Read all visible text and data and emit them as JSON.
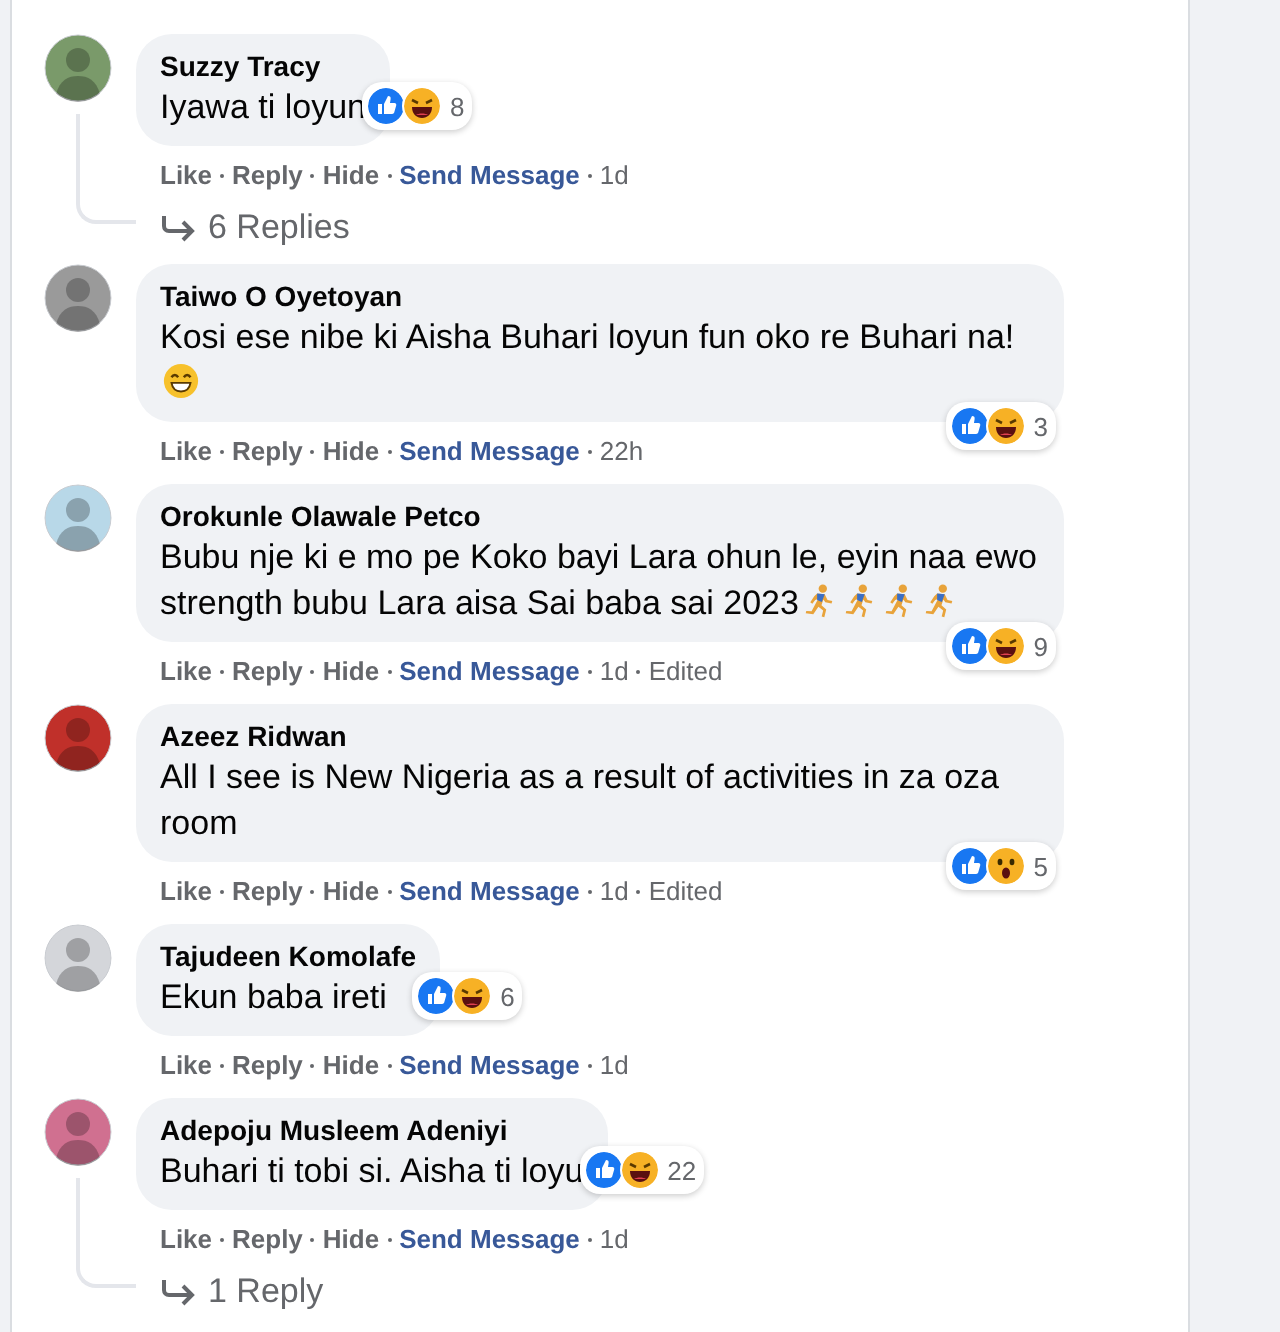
{
  "comments": [
    {
      "author": "Suzzy Tracy",
      "avatar": {
        "color": "#7a9a6a"
      },
      "text": "Iyawa ti loyun",
      "reactions": [
        {
          "kind": "like"
        },
        {
          "kind": "haha"
        }
      ],
      "reaction_count": "8",
      "actions": [
        "Like",
        "Reply",
        "Hide"
      ],
      "link": "Send Message",
      "time": "1d",
      "replies": "6 Replies"
    },
    {
      "author": "Taiwo O Oyetoyan",
      "avatar": {
        "color": "#9a9a9a"
      },
      "text": "Kosi ese nibe ki Aisha Buhari loyun fun oko re Buhari na!",
      "emoji": [
        {
          "kind": "grin"
        }
      ],
      "reactions": [
        {
          "kind": "like"
        },
        {
          "kind": "haha"
        }
      ],
      "reaction_count": "3",
      "actions": [
        "Like",
        "Reply",
        "Hide"
      ],
      "link": "Send Message",
      "time": "22h"
    },
    {
      "author": "Orokunle Olawale Petco",
      "avatar": {
        "color": "#b8d8e8"
      },
      "text": "Bubu nje ki e mo pe Koko bayi Lara ohun le, eyin naa ewo strength bubu Lara aisa Sai baba sai 2023",
      "emoji": [
        {
          "kind": "runner"
        },
        {
          "kind": "runner"
        },
        {
          "kind": "runner"
        },
        {
          "kind": "runner"
        }
      ],
      "reactions": [
        {
          "kind": "like"
        },
        {
          "kind": "haha"
        }
      ],
      "reaction_count": "9",
      "actions": [
        "Like",
        "Reply",
        "Hide"
      ],
      "link": "Send Message",
      "time": "1d",
      "edited": "Edited"
    },
    {
      "author": "Azeez Ridwan",
      "avatar": {
        "color": "#c0302a"
      },
      "text": "All I see is New Nigeria as a result of activities in za oza room",
      "reactions": [
        {
          "kind": "like"
        },
        {
          "kind": "wow"
        }
      ],
      "reaction_count": "5",
      "actions": [
        "Like",
        "Reply",
        "Hide"
      ],
      "link": "Send Message",
      "time": "1d",
      "edited": "Edited"
    },
    {
      "author": "Tajudeen Komolafe",
      "avatar": {
        "color": "#d4d6da"
      },
      "text": "Ekun baba ireti",
      "reactions": [
        {
          "kind": "like"
        },
        {
          "kind": "haha"
        }
      ],
      "reaction_count": "6",
      "actions": [
        "Like",
        "Reply",
        "Hide"
      ],
      "link": "Send Message",
      "time": "1d"
    },
    {
      "author": "Adepoju Musleem Adeniyi",
      "avatar": {
        "color": "#d07090"
      },
      "text": "Buhari ti tobi si. Aisha ti loyu",
      "reactions": [
        {
          "kind": "like"
        },
        {
          "kind": "haha"
        }
      ],
      "reaction_count": "22",
      "actions": [
        "Like",
        "Reply",
        "Hide"
      ],
      "link": "Send Message",
      "time": "1d",
      "replies": "1 Reply"
    }
  ]
}
